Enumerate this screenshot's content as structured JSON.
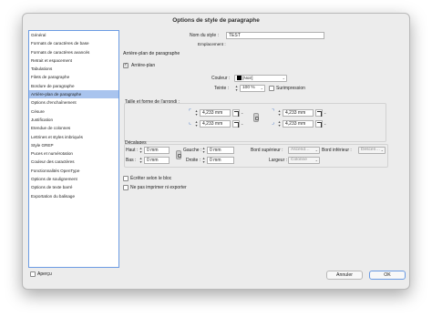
{
  "dialog": {
    "title": "Options de style de paragraphe"
  },
  "sidebar": {
    "items": [
      {
        "label": "Général"
      },
      {
        "label": "Formats de caractères de base"
      },
      {
        "label": "Formats de caractères avancés"
      },
      {
        "label": "Retrait et espacement"
      },
      {
        "label": "Tabulations"
      },
      {
        "label": "Filets de paragraphe"
      },
      {
        "label": "Bordure de paragraphe"
      },
      {
        "label": "Arrière-plan de paragraphe",
        "selected": true
      },
      {
        "label": "Options d'enchaînement"
      },
      {
        "label": "Césure"
      },
      {
        "label": "Justification"
      },
      {
        "label": "Etendue de colonnes"
      },
      {
        "label": "Lettrines et styles imbriqués"
      },
      {
        "label": "Style GREP"
      },
      {
        "label": "Puces et numérotation"
      },
      {
        "label": "Couleur des caractères"
      },
      {
        "label": "Fonctionnalités OpenType"
      },
      {
        "label": "Options de soulignement"
      },
      {
        "label": "Options de texte barré"
      },
      {
        "label": "Exportation du balisage"
      }
    ]
  },
  "header": {
    "style_name_label": "Nom du style :",
    "style_name_value": "TEST",
    "location_label": "Emplacement :",
    "section_title": "Arrière-plan de paragraphe"
  },
  "background": {
    "enable_label": "Arrière-plan",
    "enabled": true,
    "color_label": "Couleur :",
    "color_value": "[Noir]",
    "tint_label": "Teinte :",
    "tint_value": "100 %",
    "overprint_label": "Surimpression"
  },
  "corners": {
    "title": "Taille et forme de l'arrondi :",
    "top_left": "4,233 mm",
    "top_right": "4,233 mm",
    "bottom_left": "4,233 mm",
    "bottom_right": "4,233 mm"
  },
  "offsets": {
    "title": "Décalages",
    "top_label": "Haut :",
    "top_value": "0 mm",
    "bottom_label": "Bas :",
    "bottom_value": "0 mm",
    "left_label": "Gauche :",
    "left_value": "0 mm",
    "right_label": "Droite :",
    "right_value": "0 mm",
    "top_edge_label": "Bord supérieur :",
    "top_edge_value": "Ascend…",
    "bottom_edge_label": "Bord inférieur :",
    "bottom_edge_value": "Descen…",
    "width_label": "Largeur :",
    "width_value": "Colonne"
  },
  "options": {
    "clip_label": "Écrêter selon le bloc",
    "no_print_label": "Ne pas imprimer ni exporter"
  },
  "footer": {
    "preview_label": "Aperçu",
    "cancel_label": "Annuler",
    "ok_label": "OK"
  },
  "colors": {
    "selection": "#a9c4ee",
    "focus": "#6b9be3"
  }
}
